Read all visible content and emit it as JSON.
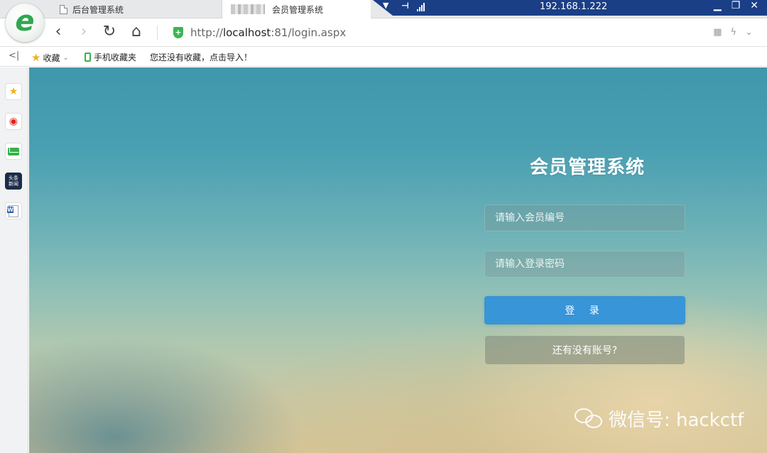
{
  "tabs": [
    {
      "label": "后台管理系统",
      "active": false
    },
    {
      "label": "会员管理系统",
      "active": true
    }
  ],
  "remote": {
    "ip": "192.168.1.222"
  },
  "address": {
    "protocol": "http://",
    "host": "localhost",
    "rest": ":81/login.aspx"
  },
  "bookmarks": {
    "favorites": "收藏",
    "mobile": "手机收藏夹",
    "import_hint": "您还没有收藏，点击导入！"
  },
  "sidebar": {
    "icons": [
      "star-icon",
      "weibo-icon",
      "mail-icon",
      "news-icon",
      "word-icon"
    ],
    "news_label": "头条新闻"
  },
  "login": {
    "title": "会员管理系统",
    "member_placeholder": "请输入会员编号",
    "password_placeholder": "请输入登录密码",
    "login_button": "登 录",
    "register_button": "还有没有账号?"
  },
  "watermark": {
    "text": "微信号: hackctf"
  },
  "colors": {
    "accent": "#3795d8",
    "remote_bar": "#1b3f86",
    "secure": "#3cb454",
    "logo": "#2fa84f"
  }
}
